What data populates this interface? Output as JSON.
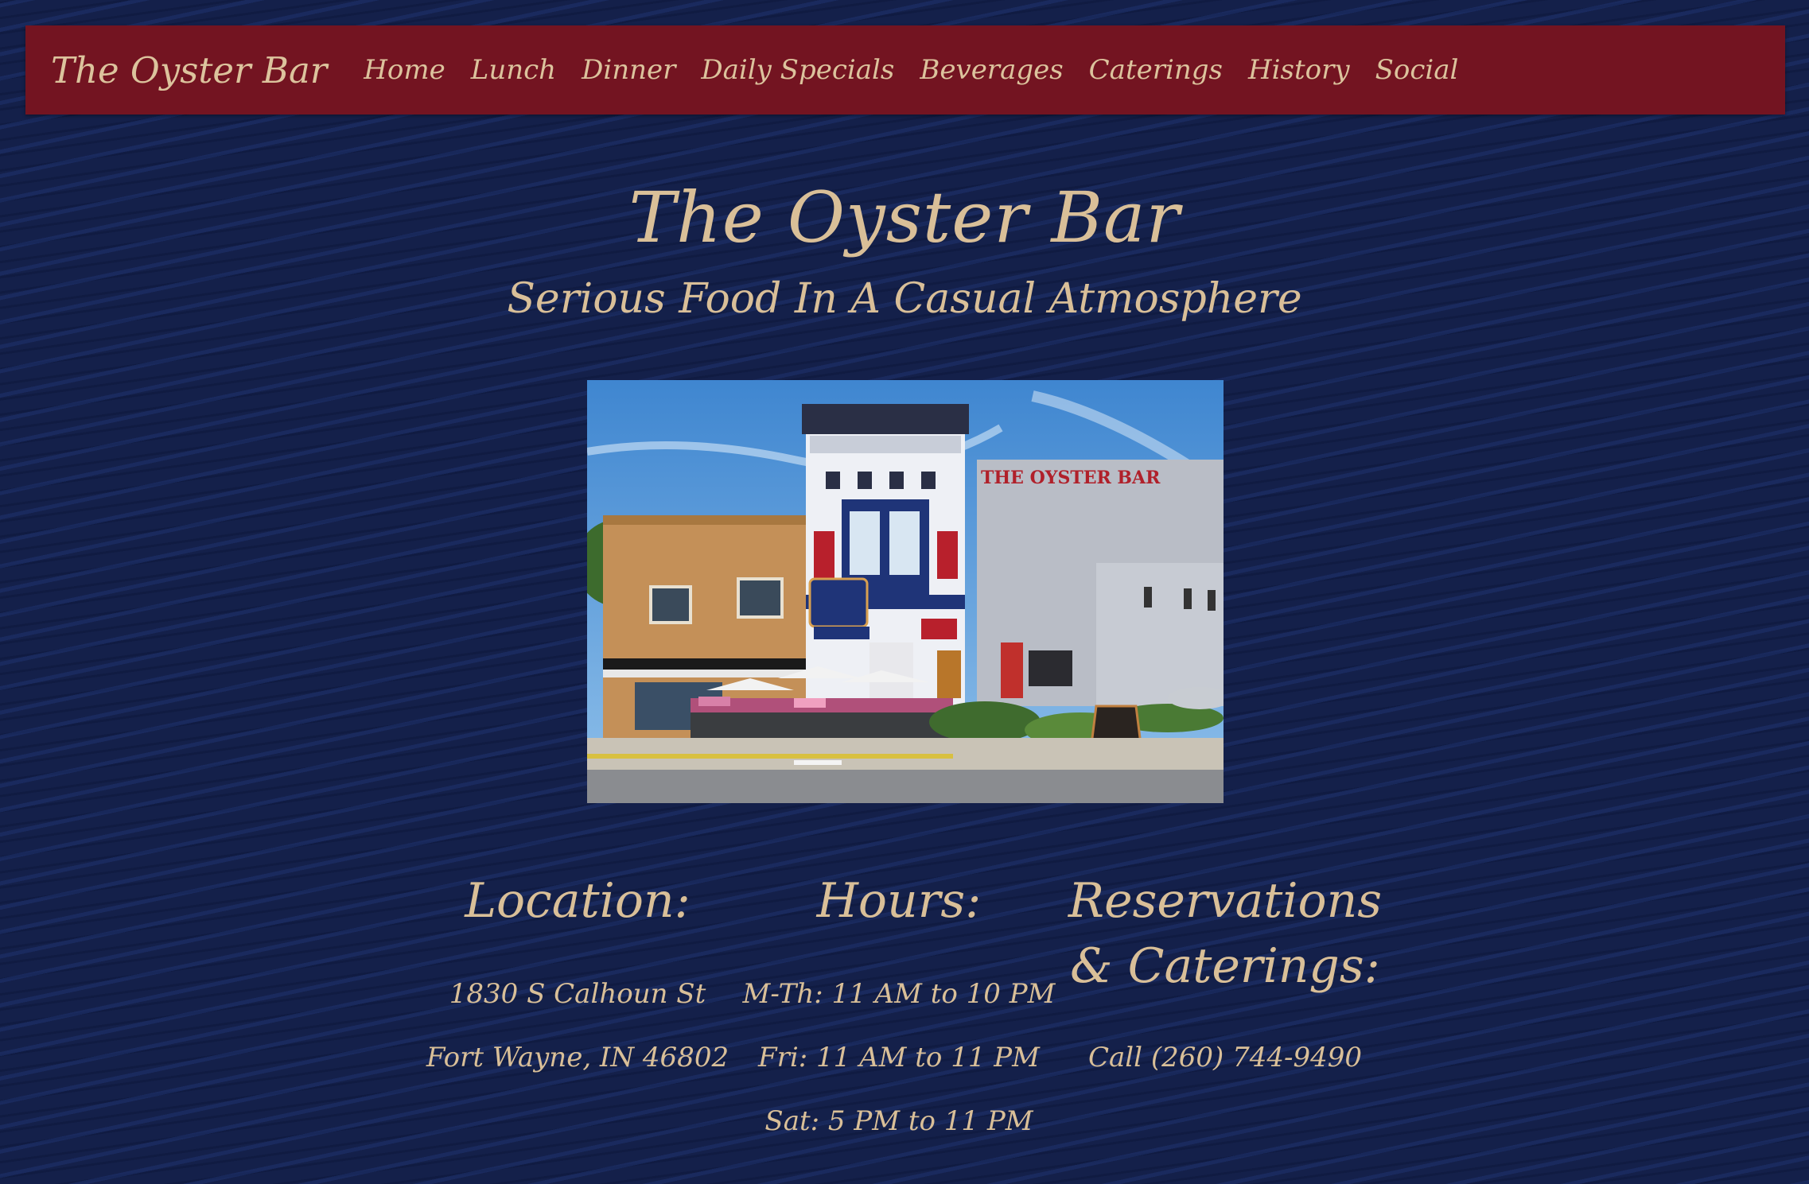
{
  "navbar": {
    "brand": "The Oyster Bar",
    "links": [
      "Home",
      "Lunch",
      "Dinner",
      "Daily Specials",
      "Beverages",
      "Caterings",
      "History",
      "Social"
    ]
  },
  "hero": {
    "title": "The Oyster Bar",
    "subtitle": "Serious Food In A Casual Atmosphere"
  },
  "location": {
    "heading": "Location:",
    "street": "1830 S Calhoun St",
    "city": "Fort Wayne, IN 46802"
  },
  "hours": {
    "heading": "Hours:",
    "lines": [
      "M-Th: 11 AM to 10 PM",
      "Fri: 11 AM to 11 PM",
      "Sat: 5 PM to 11 PM"
    ]
  },
  "reservations": {
    "heading_line1": "Reservations",
    "heading_line2": "& Caterings:",
    "phone": "Call (260) 744-9490"
  },
  "colors": {
    "background": "#14204a",
    "navbar": "#731421",
    "text": "#d9bf98"
  }
}
